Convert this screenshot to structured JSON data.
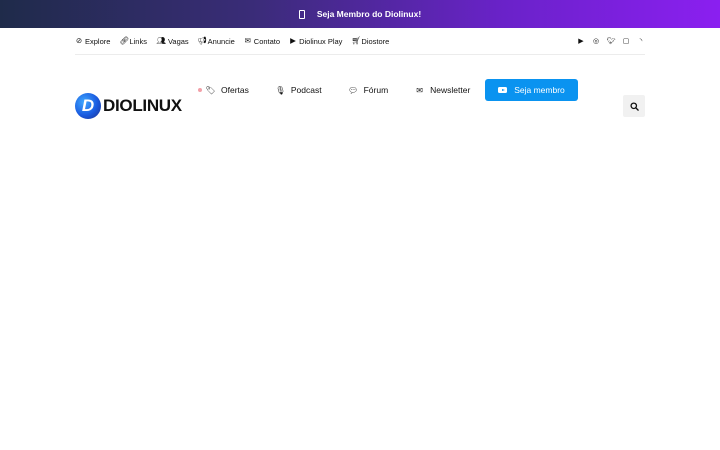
{
  "promo": {
    "label": "Seja Membro do Diolinux!"
  },
  "topnav": {
    "links": [
      {
        "label": "Explore",
        "icon": "compass-icon"
      },
      {
        "label": "Links",
        "icon": "link-icon"
      },
      {
        "label": "Vagas",
        "icon": "users-icon"
      },
      {
        "label": "Anuncie",
        "icon": "megaphone-icon"
      },
      {
        "label": "Contato",
        "icon": "envelope-icon"
      },
      {
        "label": "Diolinux Play",
        "icon": "youtube-icon"
      },
      {
        "label": "Diostore",
        "icon": "cart-icon"
      }
    ],
    "social": [
      "youtube-icon",
      "instagram-icon",
      "twitter-icon",
      "twitch-icon",
      "rss-icon"
    ]
  },
  "header": {
    "logo_letter": "D",
    "logo_text": "DIOLINUX",
    "nav": [
      {
        "label": "Ofertas",
        "icon": "tags-icon"
      },
      {
        "label": "Podcast",
        "icon": "podcast-icon"
      },
      {
        "label": "Fórum",
        "icon": "comments-icon"
      },
      {
        "label": "Newsletter",
        "icon": "envelope-icon"
      }
    ],
    "cta_label": "Seja membro",
    "accent_color": "#0a93f0"
  }
}
